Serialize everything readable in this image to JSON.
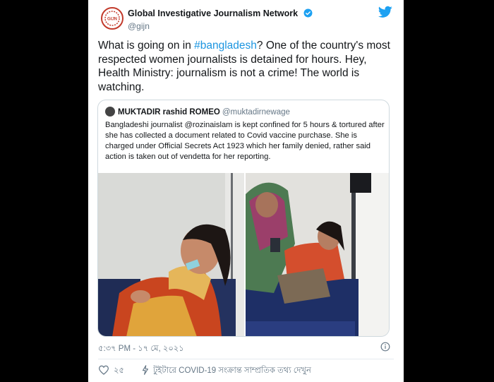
{
  "account": {
    "display_name": "Global Investigative Journalism Network",
    "handle": "@gijn",
    "avatar_icon": "gijn-logo-icon",
    "verified_icon": "verified-badge-icon"
  },
  "tweet": {
    "text_before": "What is going on in ",
    "hashtag": "#bangladesh",
    "text_after": "? One of the country's most respected women journalists is detained for hours. Hey, Health Ministry: journalism is not a crime! The world is watching."
  },
  "quoted": {
    "name": "MUKTADIR rashid ROMEO",
    "handle": "@muktadirnewage",
    "text": "Bangladeshi journalist @rozinaislam is kept confined for 5 hours & tortured after she has collected a document related to Covid vaccine purchase. She is charged under Official Secrets Act 1923 which her family denied, rather said action is taken out of vendetta for her reporting."
  },
  "timestamp": "৫:৩৭ PM - ১৭ মে, ২০২১",
  "likes": "২৫",
  "covid_link": "টুইটারে COVID-19 সংক্রান্ত সাম্প্রতিক তথ্য দেখুন",
  "colors": {
    "accent": "#1b95e0",
    "text": "#14171a",
    "muted": "#657786",
    "border": "#cfd9de",
    "gijn_red": "#c23a2b"
  }
}
